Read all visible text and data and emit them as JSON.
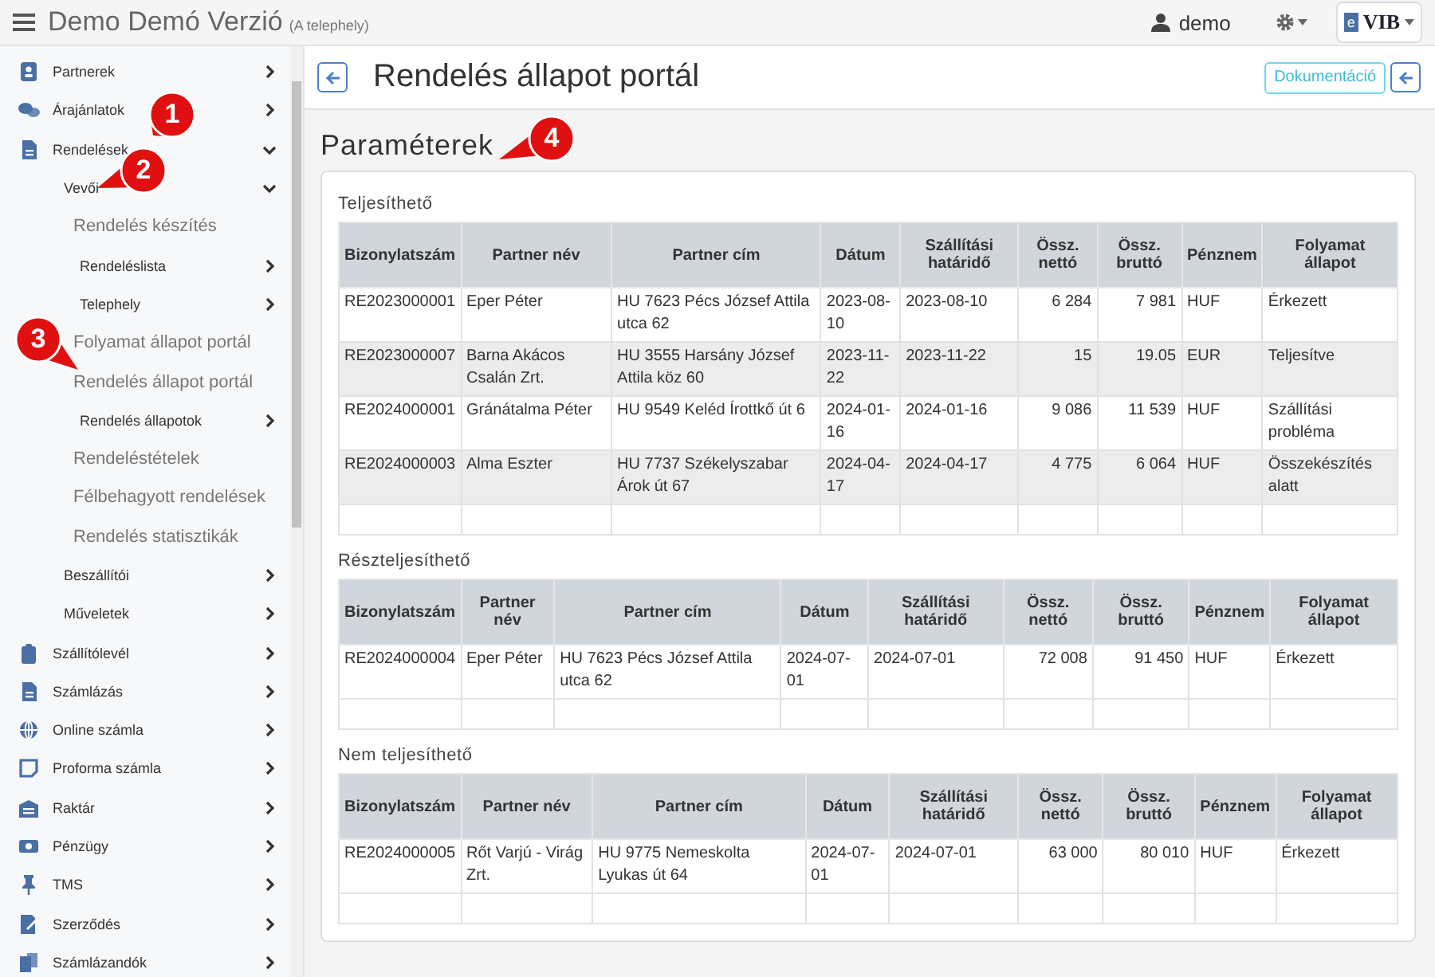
{
  "topbar": {
    "title": "Demo Demó Verzió",
    "subtitle": "(A telephely)",
    "user": "demo",
    "logo": {
      "mark": "e",
      "text": "VIB"
    }
  },
  "sidebar": {
    "items": [
      {
        "label": "Partnerek",
        "has_submenu": true,
        "expanded": false
      },
      {
        "label": "Árajánlatok",
        "has_submenu": true,
        "expanded": false
      },
      {
        "label": "Rendelések",
        "has_submenu": true,
        "expanded": true,
        "children": [
          {
            "label": "Vevői",
            "has_submenu": true,
            "expanded": true,
            "children": [
              {
                "label": "Rendelés készítés",
                "has_submenu": false,
                "expanded": false
              },
              {
                "label": "Rendeléslista",
                "has_submenu": true,
                "expanded": false
              },
              {
                "label": "Telephely",
                "has_submenu": true,
                "expanded": false
              },
              {
                "label": "Folyamat állapot portál",
                "has_submenu": false,
                "expanded": false
              },
              {
                "label": "Rendelés állapot portál",
                "has_submenu": false,
                "expanded": false
              },
              {
                "label": "Rendelés állapotok",
                "has_submenu": true,
                "expanded": false
              },
              {
                "label": "Rendeléstételek",
                "has_submenu": false,
                "expanded": false
              },
              {
                "label": "Félbehagyott rendelések",
                "has_submenu": false,
                "expanded": false
              },
              {
                "label": "Rendelés statisztikák",
                "has_submenu": false,
                "expanded": false
              }
            ]
          },
          {
            "label": "Beszállítói",
            "has_submenu": true,
            "expanded": false
          },
          {
            "label": "Műveletek",
            "has_submenu": true,
            "expanded": false
          }
        ]
      },
      {
        "label": "Szállítólevél",
        "has_submenu": true,
        "expanded": false
      },
      {
        "label": "Számlázás",
        "has_submenu": true,
        "expanded": false
      },
      {
        "label": "Online számla",
        "has_submenu": true,
        "expanded": false
      },
      {
        "label": "Proforma számla",
        "has_submenu": true,
        "expanded": false
      },
      {
        "label": "Raktár",
        "has_submenu": true,
        "expanded": false
      },
      {
        "label": "Pénzügy",
        "has_submenu": true,
        "expanded": false
      },
      {
        "label": "TMS",
        "has_submenu": true,
        "expanded": false
      },
      {
        "label": "Szerződés",
        "has_submenu": true,
        "expanded": false
      },
      {
        "label": "Számlázandók",
        "has_submenu": true,
        "expanded": false
      }
    ]
  },
  "page": {
    "title": "Rendelés állapot portál",
    "doc_button": "Dokumentáció",
    "section_title": "Paraméterek"
  },
  "tables": [
    {
      "title": "Teljesíthető",
      "columns": [
        "Bizonylatszám",
        "Partner név",
        "Partner cím",
        "Dátum",
        "Szállítási határidő",
        "Össz. nettó",
        "Össz. bruttó",
        "Pénznem",
        "Folyamat állapot"
      ],
      "rows": [
        [
          "RE2023000001",
          "Eper Péter",
          "HU 7623 Pécs József Attila utca 62",
          "2023-08-10",
          "2023-08-10",
          "6 284",
          "7 981",
          "HUF",
          "Érkezett"
        ],
        [
          "RE2023000007",
          "Barna Akácos Csalán Zrt.",
          "HU 3555 Harsány József Attila köz 60",
          "2023-11-22",
          "2023-11-22",
          "15",
          "19.05",
          "EUR",
          "Teljesítve"
        ],
        [
          "RE2024000001",
          "Gránátalma Péter",
          "HU 9549 Keléd Írottkő út 6",
          "2024-01-16",
          "2024-01-16",
          "9 086",
          "11 539",
          "HUF",
          "Szállítási probléma"
        ],
        [
          "RE2024000003",
          "Alma Eszter",
          "HU 7737 Székelyszabar Árok út 67",
          "2024-04-17",
          "2024-04-17",
          "4 775",
          "6 064",
          "HUF",
          "Összekészítés alatt"
        ]
      ]
    },
    {
      "title": "Részteljesíthető",
      "columns": [
        "Bizonylatszám",
        "Partner név",
        "Partner cím",
        "Dátum",
        "Szállítási határidő",
        "Össz. nettó",
        "Össz. bruttó",
        "Pénznem",
        "Folyamat állapot"
      ],
      "rows": [
        [
          "RE2024000004",
          "Eper Péter",
          "HU 7623 Pécs József Attila utca 62",
          "2024-07-01",
          "2024-07-01",
          "72 008",
          "91 450",
          "HUF",
          "Érkezett"
        ]
      ]
    },
    {
      "title": "Nem teljesíthető",
      "columns": [
        "Bizonylatszám",
        "Partner név",
        "Partner cím",
        "Dátum",
        "Szállítási határidő",
        "Össz. nettó",
        "Össz. bruttó",
        "Pénznem",
        "Folyamat állapot"
      ],
      "rows": [
        [
          "RE2024000005",
          "Rőt Varjú - Virág Zrt.",
          "HU 9775 Nemeskolta Lyukas út 64",
          "2024-07-01",
          "2024-07-01",
          "63 000",
          "80 010",
          "HUF",
          "Érkezett"
        ]
      ]
    }
  ],
  "callouts": [
    {
      "label": "1"
    },
    {
      "label": "2"
    },
    {
      "label": "3"
    },
    {
      "label": "4"
    }
  ]
}
